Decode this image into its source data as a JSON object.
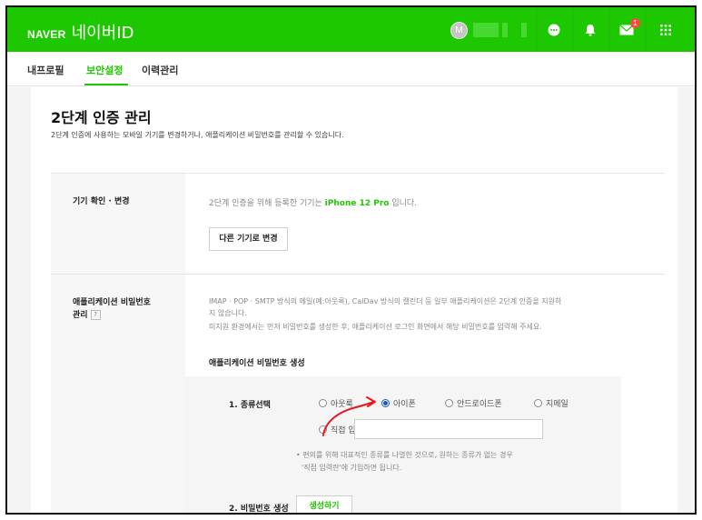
{
  "header": {
    "brand": "NAVER",
    "title": "네이버ID",
    "avatar_initial": "M",
    "mail_badge": "1"
  },
  "tabs": [
    {
      "label": "내프로필",
      "active": false
    },
    {
      "label": "보안설정",
      "active": true
    },
    {
      "label": "이력관리",
      "active": false
    }
  ],
  "page": {
    "title": "2단계 인증 관리",
    "description": "2단계 인증에 사용하는 모바일 기기를 변경하거나, 애플리케이션 비밀번호를 관리할 수 있습니다."
  },
  "device_section": {
    "label": "기기 확인 · 변경",
    "text_prefix": "2단계 인증을 위해 등록한 기기는 ",
    "device_name": "iPhone 12 Pro",
    "text_suffix": " 입니다.",
    "change_button": "다른 기기로 변경"
  },
  "app_password_section": {
    "label_line1": "애플리케이션 비밀번호",
    "label_line2": "관리",
    "help_icon": "?",
    "desc_line1": "IMAP · POP · SMTP 방식의 메일(예:아웃룩), CalDav 방식의 캘린더 등 일부 애플리케이션은 2단계 인증을 지원하",
    "desc_line2": "지 않습니다.",
    "desc_line3": "미지원 환경에서는 먼저 비밀번호를 생성한 후, 애플리케이션 로그인 화면에서 해당 비밀번호를 입력해 주세요.",
    "generate_title": "애플리케이션 비밀번호 생성",
    "step1_label": "1. 종류선택",
    "options": [
      {
        "label": "아웃룩",
        "checked": false
      },
      {
        "label": "아이폰",
        "checked": true
      },
      {
        "label": "안드로이드폰",
        "checked": false
      },
      {
        "label": "지메일",
        "checked": false
      },
      {
        "label": "직접 입력",
        "checked": false
      }
    ],
    "direct_input_value": "",
    "note_line1": "• 편의를 위해 대표적인 종류를 나열한 것으로, 원하는 종류가 없는 경우",
    "note_line2": "'직접 입력란'에 기입하면 됩니다.",
    "step2_label": "2. 비밀번호 생성",
    "generate_button": "생성하기"
  },
  "colors": {
    "brand_green": "#1ec800",
    "radio_selected": "#1a56c5",
    "annotation_red": "#e8171d"
  }
}
